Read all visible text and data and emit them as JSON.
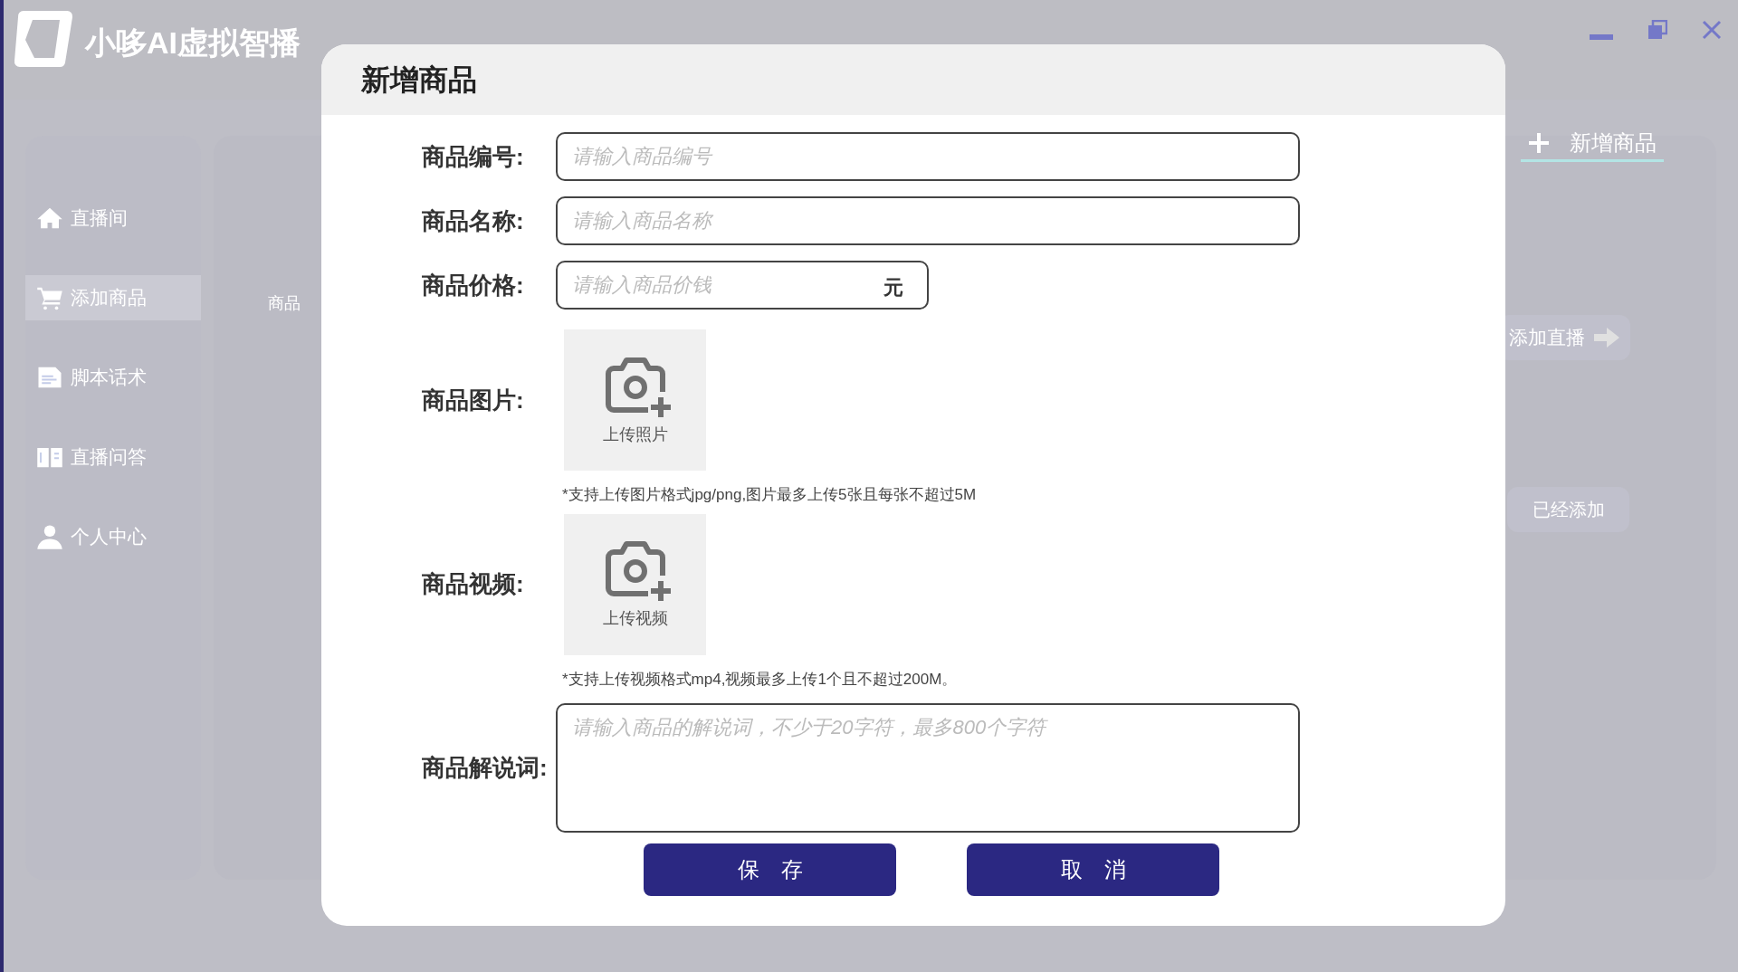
{
  "app": {
    "title": "小哆AI虚拟智播"
  },
  "sidebar": {
    "items": [
      {
        "label": "直播间",
        "selected": false
      },
      {
        "label": "添加商品",
        "selected": true
      },
      {
        "label": "脚本话术",
        "selected": false
      },
      {
        "label": "直播问答",
        "selected": false
      },
      {
        "label": "个人中心",
        "selected": false
      }
    ]
  },
  "background": {
    "column_label": "商品",
    "new_button": "新增商品",
    "add_live_button": "添加直播",
    "added_label": "已经添加"
  },
  "dialog": {
    "title": "新增商品",
    "fields": [
      {
        "kind": "input",
        "label": "商品编号:",
        "placeholder": "请输入商品编号"
      },
      {
        "kind": "input",
        "label": "商品名称:",
        "placeholder": "请输入商品名称"
      },
      {
        "kind": "price",
        "label": "商品价格:",
        "placeholder": "请输入商品价钱",
        "unit": "元"
      },
      {
        "kind": "upload",
        "label": "商品图片:",
        "button": "上传照片",
        "hint": "*支持上传图片格式jpg/png,图片最多上传5张且每张不超过5M"
      },
      {
        "kind": "upload",
        "label": "商品视频:",
        "button": "上传视频",
        "hint": "*支持上传视频格式mp4,视频最多上传1个且不超过200M。"
      },
      {
        "kind": "textarea",
        "label": "商品解说词:",
        "placeholder": "请输入商品的解说词，不少于20字符，最多800个字符"
      }
    ],
    "buttons": [
      "保　存",
      "取　消"
    ]
  }
}
